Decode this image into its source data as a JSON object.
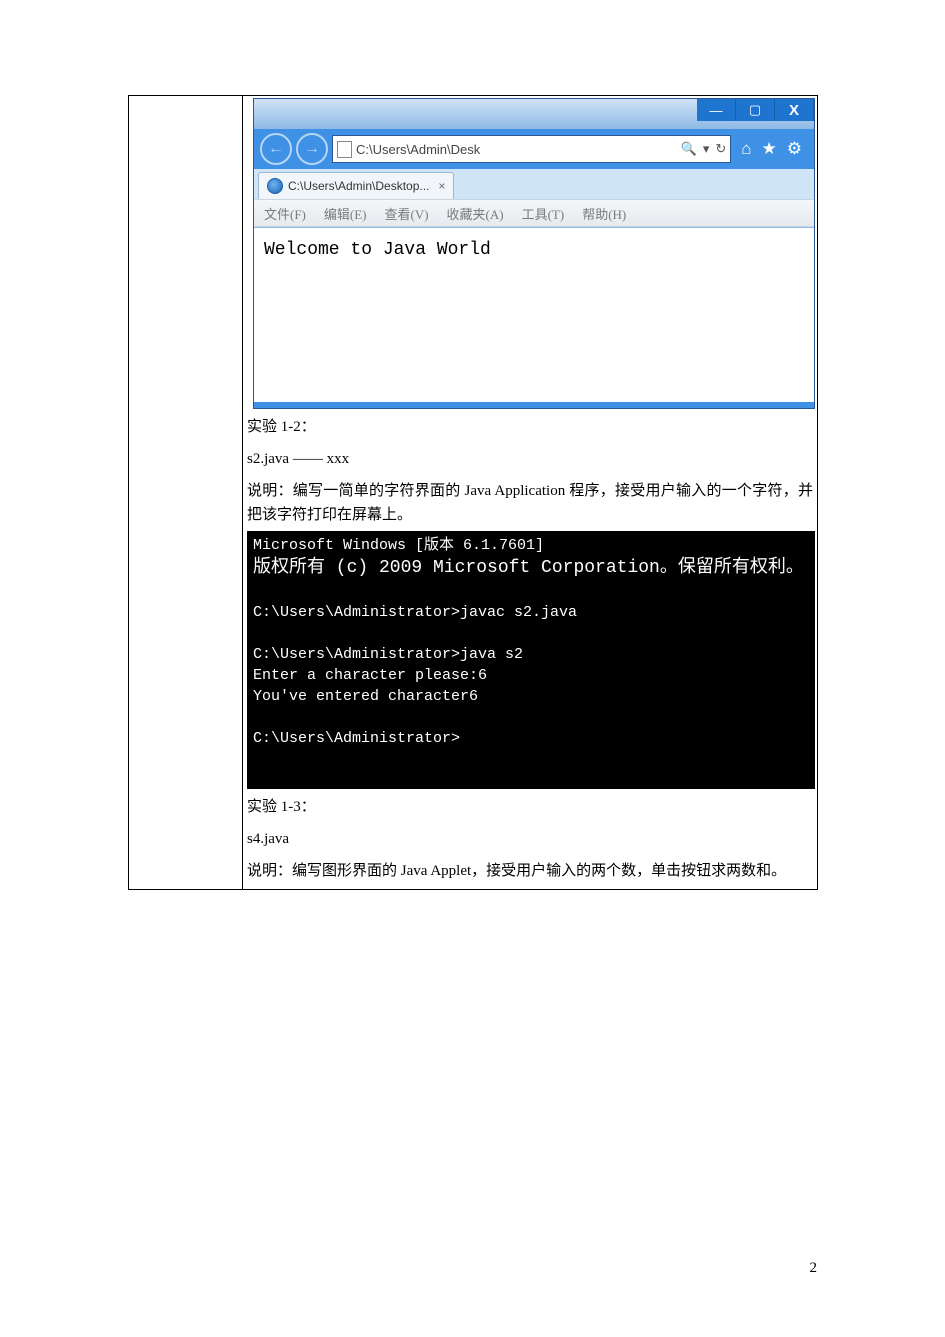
{
  "browser": {
    "winbuttons": {
      "min": "—",
      "max": "▢",
      "close": "X"
    },
    "nav": {
      "back": "←",
      "forward": "→",
      "address": "C:\\Users\\Admin\\Desk",
      "search_icon": "🔍",
      "dropdown": "▾",
      "refresh": "↻",
      "home": "⌂",
      "star": "★",
      "gear": "⚙"
    },
    "tab": {
      "title": "C:\\Users\\Admin\\Desktop...",
      "close": "×"
    },
    "menubar": {
      "file": "文件(F)",
      "edit": "编辑(E)",
      "view": "查看(V)",
      "favorites": "收藏夹(A)",
      "tools": "工具(T)",
      "help": "帮助(H)"
    },
    "page_content": "Welcome to Java World"
  },
  "exp12": {
    "title": "实验 1-2：",
    "file": "s2.java  —— xxx",
    "desc": "说明：编写一简单的字符界面的 Java Application 程序，接受用户输入的一个字符，并把该字符打印在屏幕上。"
  },
  "console_lines": {
    "l0": "Microsoft Windows [版本 6.1.7601]",
    "l1": "版权所有 (c) 2009 Microsoft Corporation。保留所有权利。",
    "l2": "",
    "l3": "C:\\Users\\Administrator>javac s2.java",
    "l4": "",
    "l5": "C:\\Users\\Administrator>java s2",
    "l6": "Enter a character please:6",
    "l7": "You've entered character6",
    "l8": "",
    "l9": "C:\\Users\\Administrator>"
  },
  "exp13": {
    "title": "实验 1-3：",
    "file": "s4.java",
    "desc": "说明：编写图形界面的 Java Applet，接受用户输入的两个数，单击按钮求两数和。"
  },
  "page_number": "2"
}
